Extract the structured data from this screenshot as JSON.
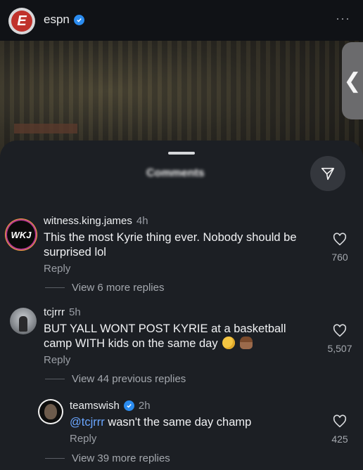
{
  "header": {
    "logo_letter": "E",
    "account_name": "espn",
    "more_icon": "more-horizontal-icon"
  },
  "video": {
    "back_glyph": "❮"
  },
  "sheet": {
    "title": "Comments"
  },
  "comments": [
    {
      "username": "witness.king.james",
      "time": "4h",
      "avatar_text": "WKJ",
      "text": "This the most Kyrie thing ever. Nobody should be surprised lol",
      "likes": "760",
      "reply_label": "Reply",
      "view_more": "View 6 more replies"
    },
    {
      "username": "tcjrrr",
      "time": "5h",
      "text": "BUT YALL WONT POST KYRIE  at a basketball camp WITH kids on the same day",
      "likes": "5,507",
      "reply_label": "Reply",
      "view_more": "View 44 previous replies"
    },
    {
      "username": "teamswish",
      "time": "2h",
      "mention": "@tcjrrr",
      "text": " wasn't the same day champ",
      "likes": "425",
      "reply_label": "Reply",
      "view_more": "View 39 more replies"
    }
  ]
}
